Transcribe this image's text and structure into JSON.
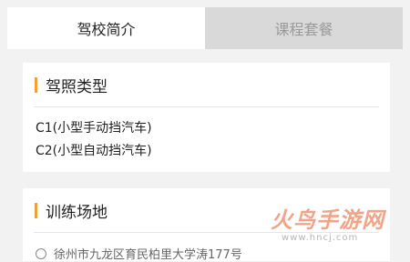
{
  "tabs": [
    {
      "label": "驾校简介",
      "active": true
    },
    {
      "label": "课程套餐",
      "active": false
    }
  ],
  "license_section": {
    "title": "驾照类型",
    "items": [
      "C1(小型手动挡汽车)",
      "C2(小型自动挡汽车)"
    ]
  },
  "venue_section": {
    "title": "训练场地",
    "address_partial": "徐州市九龙区育民柏里大学涛177号"
  },
  "watermark": {
    "brand": "火鸟手游网",
    "url": "www.hncj.com"
  },
  "colors": {
    "accent": "#f0a23a",
    "background": "#f2f2f2",
    "inactive_tab": "#d9d9d9"
  }
}
